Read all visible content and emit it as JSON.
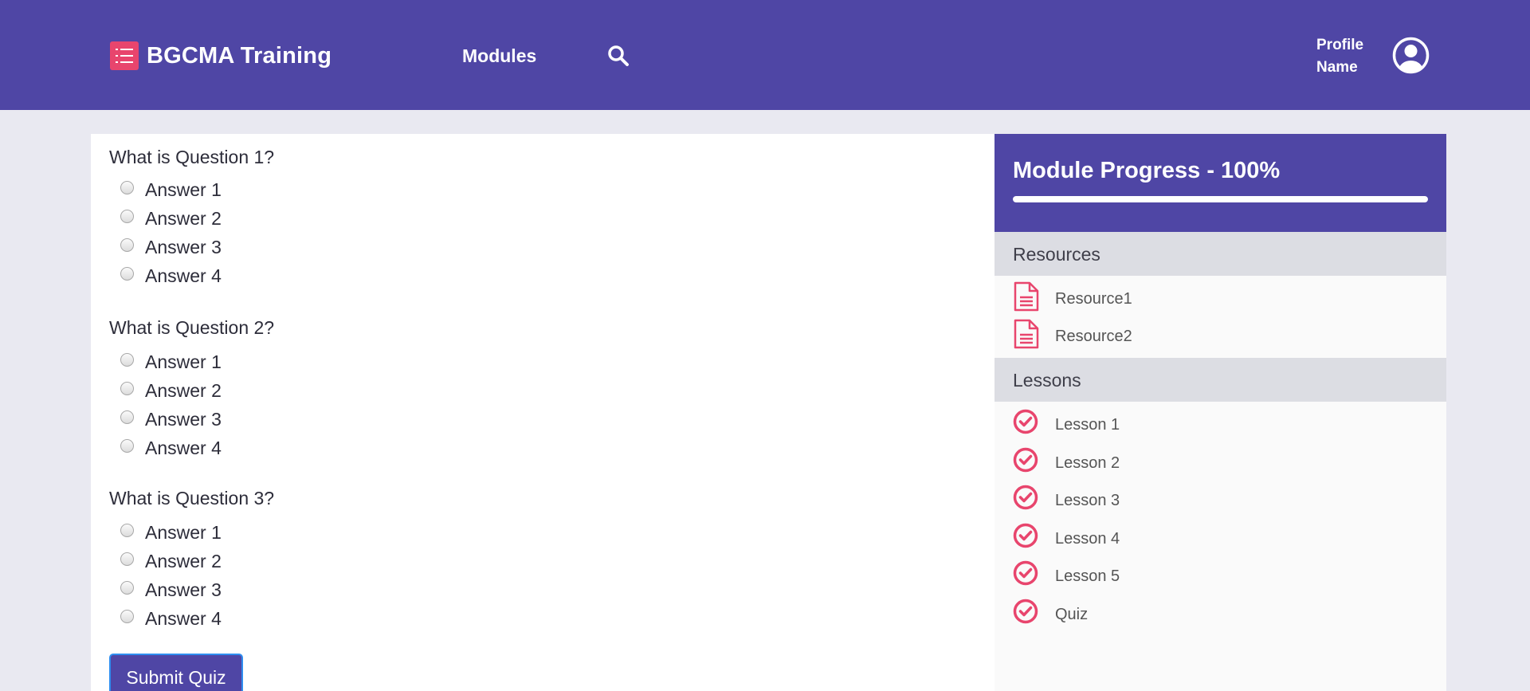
{
  "header": {
    "brand": "BGCMA Training",
    "nav_modules": "Modules",
    "profile_name": "Profile Name"
  },
  "quiz": {
    "questions": [
      {
        "text": "What is Question 1?",
        "answers": [
          "Answer 1",
          "Answer 2",
          "Answer 3",
          "Answer 4"
        ]
      },
      {
        "text": "What is Question 2?",
        "answers": [
          "Answer 1",
          "Answer 2",
          "Answer 3",
          "Answer 4"
        ]
      },
      {
        "text": "What is Question 3?",
        "answers": [
          "Answer 1",
          "Answer 2",
          "Answer 3",
          "Answer 4"
        ]
      }
    ],
    "submit_label": "Submit Quiz"
  },
  "sidebar": {
    "progress_title": "Module Progress - 100%",
    "progress_value": 100,
    "resources_heading": "Resources",
    "resources": [
      "Resource1",
      "Resource2"
    ],
    "lessons_heading": "Lessons",
    "lessons": [
      "Lesson 1",
      "Lesson 2",
      "Lesson 3",
      "Lesson 4",
      "Lesson 5",
      "Quiz"
    ]
  },
  "colors": {
    "primary": "#4f46a5",
    "accent": "#e8456d",
    "background": "#e9e9f1"
  },
  "icons": {
    "brand": "list-icon",
    "search": "search-icon",
    "avatar": "user-circle-icon",
    "resource": "document-icon",
    "lesson_status": "check-circle-icon"
  }
}
